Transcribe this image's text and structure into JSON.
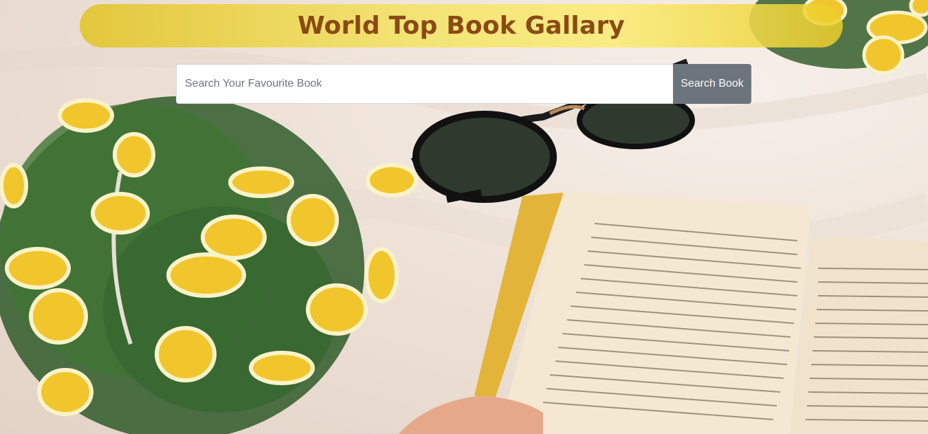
{
  "header": {
    "title": "World Top Book Gallary"
  },
  "search": {
    "placeholder": "Search Your Favourite Book",
    "value": "",
    "button_label": "Search Book"
  },
  "colors": {
    "title_text": "#8a4a16",
    "banner": "#f2dc5a",
    "search_button": "#6c757d"
  }
}
